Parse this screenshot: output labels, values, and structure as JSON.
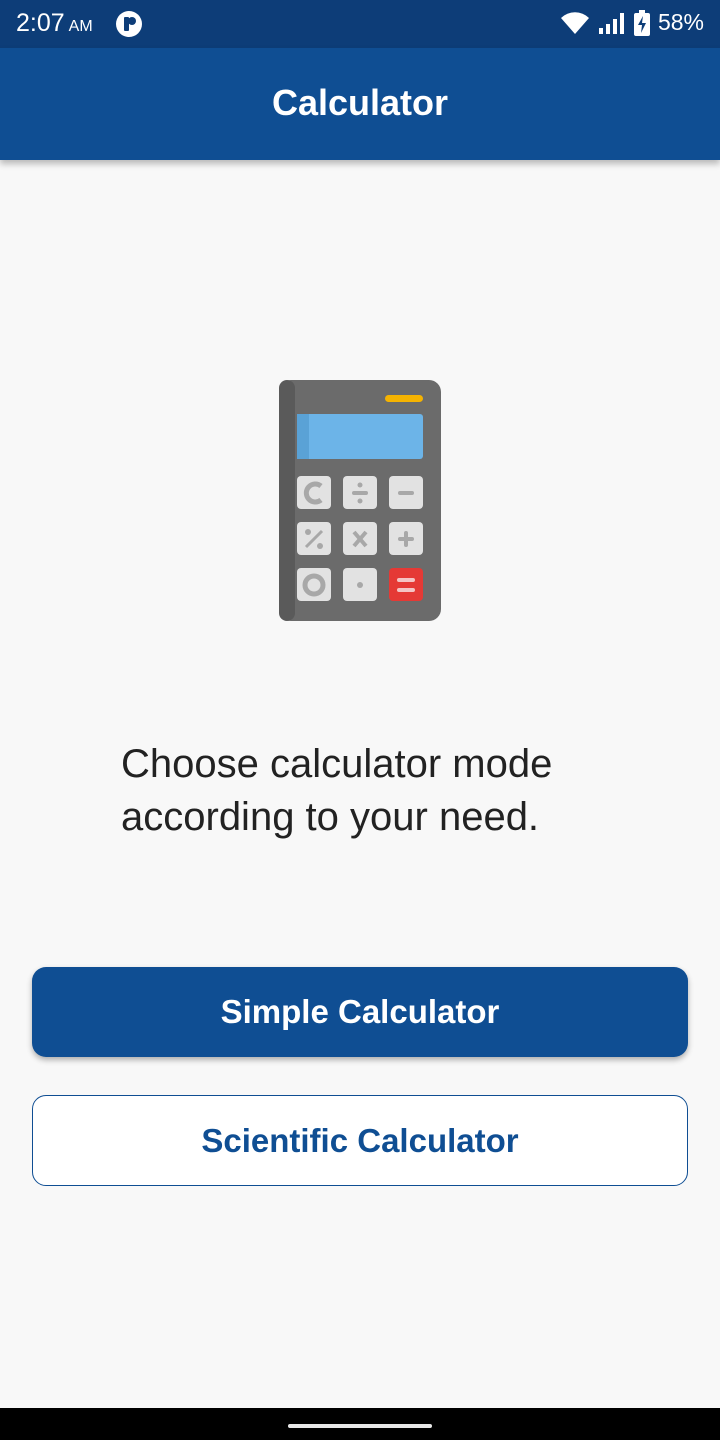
{
  "status_bar": {
    "time": "2:07",
    "ampm": "AM",
    "battery": "58%",
    "icons": [
      "app-notification-icon",
      "wifi-icon",
      "signal-icon",
      "battery-charging-icon"
    ]
  },
  "app_bar": {
    "title": "Calculator"
  },
  "illustration": {
    "icon": "calculator-icon",
    "colors": {
      "body": "#6b6b6b",
      "screen": "#6cb4e8",
      "keys": "#e2e2e2",
      "equals": "#e53935",
      "accent": "#f5b301"
    }
  },
  "main": {
    "prompt": "Choose calculator mode according to your need."
  },
  "buttons": {
    "simple": "Simple Calculator",
    "scientific": "Scientific Calculator"
  },
  "colors": {
    "primary": "#0f4e93",
    "status": "#0d3d78",
    "background": "#f8f8f8"
  }
}
